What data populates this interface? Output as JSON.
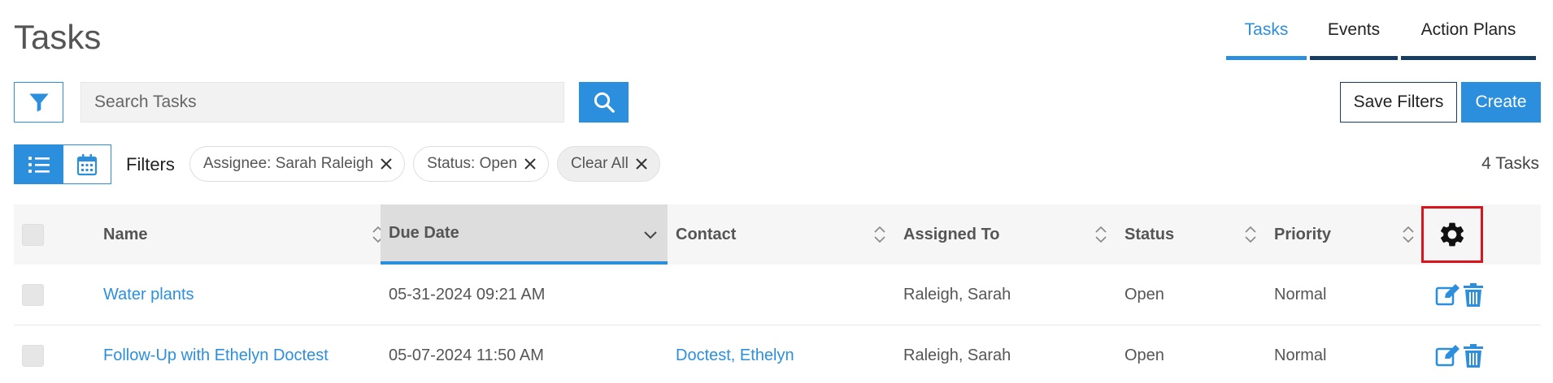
{
  "page": {
    "title": "Tasks"
  },
  "nav_tabs": [
    {
      "label": "Tasks",
      "active": true
    },
    {
      "label": "Events",
      "active": false
    },
    {
      "label": "Action Plans",
      "active": false
    }
  ],
  "search": {
    "placeholder": "Search Tasks",
    "value": ""
  },
  "toolbar": {
    "save_filters_label": "Save Filters",
    "create_label": "Create"
  },
  "filters": {
    "label": "Filters",
    "chips": [
      {
        "label": "Assignee: Sarah Raleigh"
      },
      {
        "label": "Status: Open"
      },
      {
        "label": "Clear All"
      }
    ]
  },
  "task_count": "4 Tasks",
  "table": {
    "columns": [
      {
        "label": "Name"
      },
      {
        "label": "Due Date"
      },
      {
        "label": "Contact"
      },
      {
        "label": "Assigned To"
      },
      {
        "label": "Status"
      },
      {
        "label": "Priority"
      }
    ],
    "rows": [
      {
        "name": "Water plants",
        "due_date": "05-31-2024 09:21 AM",
        "contact": "",
        "assigned_to": "Raleigh, Sarah",
        "status": "Open",
        "priority": "Normal"
      },
      {
        "name": "Follow-Up with Ethelyn Doctest",
        "due_date": "05-07-2024 11:50 AM",
        "contact": "Doctest, Ethelyn",
        "assigned_to": "Raleigh, Sarah",
        "status": "Open",
        "priority": "Normal"
      }
    ]
  },
  "colors": {
    "accent": "#2b8fde",
    "navy": "#173d63",
    "highlight": "#d9141c"
  },
  "icons": {
    "filter": "filter-icon",
    "search": "search-icon",
    "list_view": "list-icon",
    "calendar_view": "calendar-icon",
    "remove": "close-icon",
    "sort": "sort-icon",
    "sorted_desc": "chevron-down-icon",
    "settings": "gear-icon",
    "edit": "edit-icon",
    "delete": "trash-icon"
  }
}
